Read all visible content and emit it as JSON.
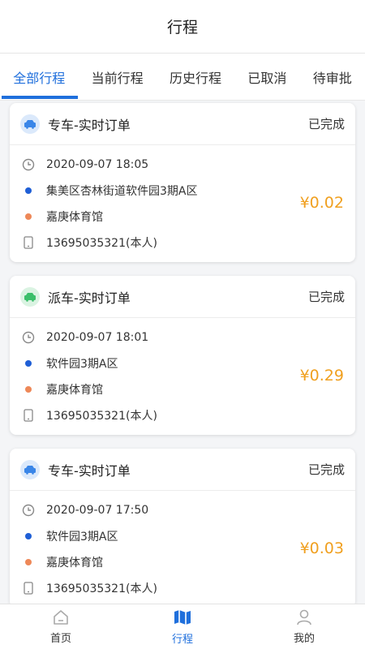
{
  "header": {
    "title": "行程"
  },
  "tabs": [
    {
      "label": "全部行程",
      "active": true
    },
    {
      "label": "当前行程"
    },
    {
      "label": "历史行程"
    },
    {
      "label": "已取消"
    },
    {
      "label": "待审批"
    }
  ],
  "orders": [
    {
      "type": "专车-实时订单",
      "icon": "car-icon",
      "status": "已完成",
      "time": "2020-09-07 18:05",
      "from": "集美区杏林街道软件园3期A区",
      "to": "嘉庚体育馆",
      "phone": "13695035321(本人)",
      "price": "¥0.02"
    },
    {
      "type": "派车-实时订单",
      "icon": "dispatch-car-icon",
      "status": "已完成",
      "time": "2020-09-07 18:01",
      "from": "软件园3期A区",
      "to": "嘉庚体育馆",
      "phone": "13695035321(本人)",
      "price": "¥0.29"
    },
    {
      "type": "专车-实时订单",
      "icon": "car-icon",
      "status": "已完成",
      "time": "2020-09-07 17:50",
      "from": "软件园3期A区",
      "to": "嘉庚体育馆",
      "phone": "13695035321(本人)",
      "price": "¥0.03"
    }
  ],
  "bottom_nav": [
    {
      "label": "首页",
      "icon": "home-icon"
    },
    {
      "label": "行程",
      "icon": "map-icon",
      "active": true
    },
    {
      "label": "我的",
      "icon": "person-icon"
    }
  ],
  "colors": {
    "accent": "#1f6fdc",
    "price": "#f0a020",
    "origin_dot": "#1f5fd6",
    "destination_dot": "#ee8858"
  }
}
